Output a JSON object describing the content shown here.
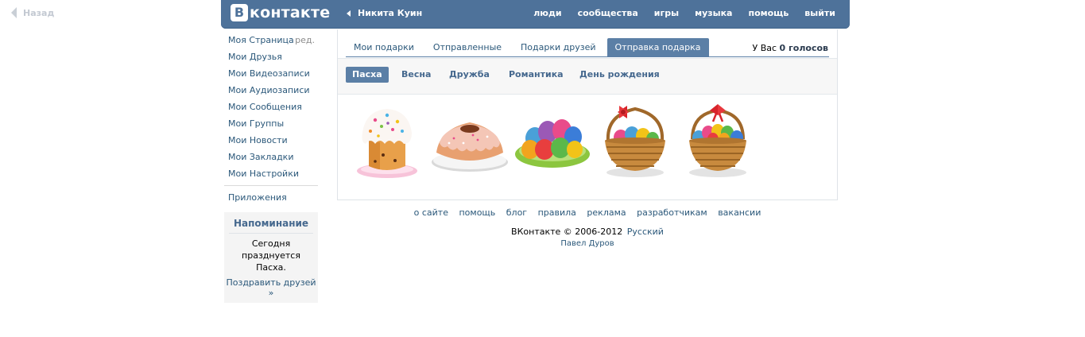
{
  "back": {
    "label": "Назад"
  },
  "header": {
    "logo_letter": "B",
    "logo_text": "контакте",
    "user_name": "Никита Куин",
    "nav": [
      "люди",
      "сообщества",
      "игры",
      "музыка",
      "помощь",
      "выйти"
    ]
  },
  "sidebar": {
    "items": [
      {
        "label": "Моя Страница",
        "edit": "ред."
      },
      {
        "label": "Мои Друзья"
      },
      {
        "label": "Мои Видеозаписи"
      },
      {
        "label": "Мои Аудиозаписи"
      },
      {
        "label": "Мои Сообщения"
      },
      {
        "label": "Мои Группы"
      },
      {
        "label": "Мои Новости"
      },
      {
        "label": "Мои Закладки"
      },
      {
        "label": "Мои Настройки"
      }
    ],
    "apps": "Приложения"
  },
  "reminder": {
    "title": "Напоминание",
    "text": "Сегодня празднуется Пасха.",
    "link": "Поздравить друзей »"
  },
  "tabs": [
    "Мои подарки",
    "Отправленные",
    "Подарки друзей",
    "Отправка подарка"
  ],
  "active_tab": "Отправка подарка",
  "votes": {
    "prefix": "У Вас",
    "count": "0 голосов"
  },
  "categories": [
    "Пасха",
    "Весна",
    "Дружба",
    "Романтика",
    "День рождения"
  ],
  "active_category": "Пасха",
  "gifts": [
    {
      "name": "kulich-gift-icon"
    },
    {
      "name": "bundt-cake-gift-icon"
    },
    {
      "name": "egg-plate-gift-icon"
    },
    {
      "name": "egg-basket-bow-gift-icon"
    },
    {
      "name": "egg-basket-full-gift-icon"
    }
  ],
  "footer": {
    "links": [
      "о сайте",
      "помощь",
      "блог",
      "правила",
      "реклама",
      "разработчикам",
      "вакансии"
    ],
    "copyright": "ВКонтакте © 2006-2012",
    "language": "Русский",
    "author": "Павел Дуров"
  },
  "colors": {
    "header": "#4e729a",
    "link": "#2b587a",
    "tab_active": "#5b7fa6"
  }
}
